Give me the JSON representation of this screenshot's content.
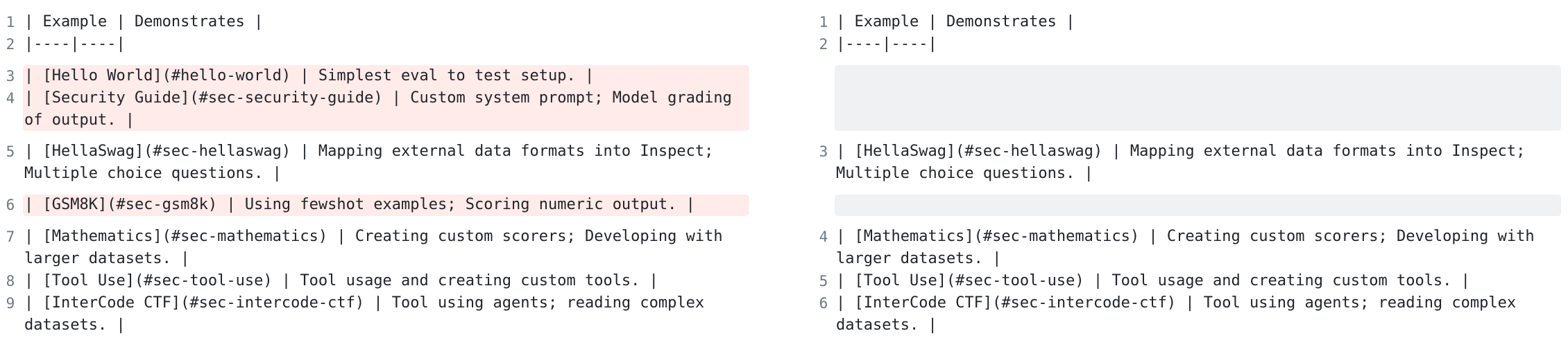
{
  "left": {
    "lines": [
      {
        "num": "1",
        "text": "| Example | Demonstrates |"
      },
      {
        "num": "2",
        "text": "|----|----|"
      },
      {
        "num": "3",
        "text": "| [Hello World](#hello-world) | Simplest eval to test setup. |"
      },
      {
        "num": "4",
        "text": "| [Security Guide](#sec-security-guide) | Custom system prompt; Model grading of output. |"
      },
      {
        "num": "5",
        "text": "| [HellaSwag](#sec-hellaswag) | Mapping external data formats into Inspect; Multiple choice questions. |"
      },
      {
        "num": "6",
        "text": "| [GSM8K](#sec-gsm8k) | Using fewshot examples; Scoring numeric output. |"
      },
      {
        "num": "7",
        "text": "| [Mathematics](#sec-mathematics) | Creating custom scorers; Developing with larger datasets. |"
      },
      {
        "num": "8",
        "text": "| [Tool Use](#sec-tool-use) | Tool usage and creating custom tools. |"
      },
      {
        "num": "9",
        "text": "| [InterCode CTF](#sec-intercode-ctf) | Tool using agents; reading complex datasets. |"
      }
    ]
  },
  "right": {
    "lines": [
      {
        "num": "1",
        "text": "| Example | Demonstrates |"
      },
      {
        "num": "2",
        "text": "|----|----|"
      },
      {
        "num": "3",
        "text": "| [HellaSwag](#sec-hellaswag) | Mapping external data formats into Inspect; Multiple choice questions. |"
      },
      {
        "num": "4",
        "text": "| [Mathematics](#sec-mathematics) | Creating custom scorers; Developing with larger datasets. |"
      },
      {
        "num": "5",
        "text": "| [Tool Use](#sec-tool-use) | Tool usage and creating custom tools. |"
      },
      {
        "num": "6",
        "text": "| [InterCode CTF](#sec-intercode-ctf) | Tool using agents; reading complex datasets. |"
      }
    ]
  },
  "colors": {
    "removed_background": "#ffebe9",
    "placeholder_background": "#eff1f3",
    "line_number": "#6e7781",
    "text": "#1f2328"
  }
}
